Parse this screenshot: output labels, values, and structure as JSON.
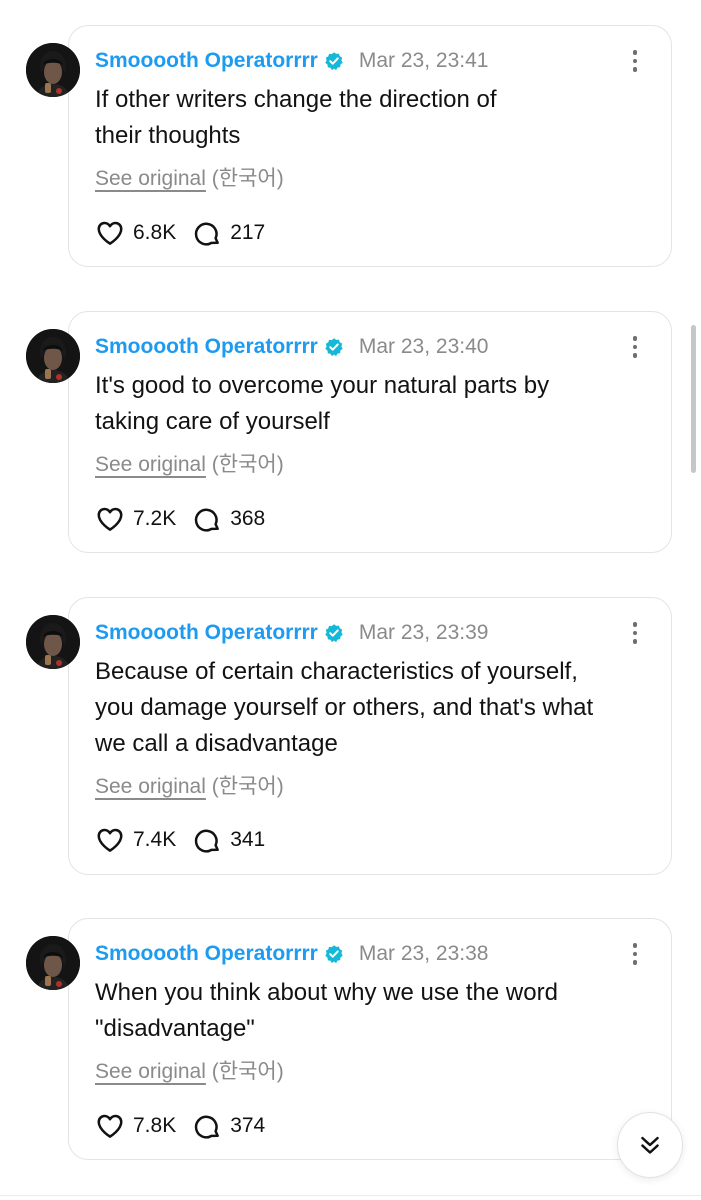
{
  "posts": [
    {
      "author": "Smooooth Operatorrrr",
      "timestamp": "Mar 23, 23:41",
      "lines": [
        "If other writers change the direction of",
        "their thoughts"
      ],
      "see_original": "See original",
      "language": "(한국어)",
      "likes": "6.8K",
      "replies": "217"
    },
    {
      "author": "Smooooth Operatorrrr",
      "timestamp": "Mar 23, 23:40",
      "lines": [
        "It's good to overcome your natural parts by",
        "taking care of yourself"
      ],
      "see_original": "See original",
      "language": "(한국어)",
      "likes": "7.2K",
      "replies": "368"
    },
    {
      "author": "Smooooth Operatorrrr",
      "timestamp": "Mar 23, 23:39",
      "lines": [
        "Because of certain characteristics of yourself,",
        "you damage yourself or others, and that's what",
        "we call a disadvantage"
      ],
      "see_original": "See original",
      "language": "(한국어)",
      "likes": "7.4K",
      "replies": "341"
    },
    {
      "author": "Smooooth Operatorrrr",
      "timestamp": "Mar 23, 23:38",
      "lines": [
        "When you think about why we use the word",
        "\"disadvantage\""
      ],
      "see_original": "See original",
      "language": "(한국어)",
      "likes": "7.8K",
      "replies": "374"
    }
  ],
  "icons": {
    "verified": "verified-badge-icon",
    "more": "more-vertical-icon",
    "like": "heart-icon",
    "reply": "speech-bubble-icon",
    "scroll_down": "double-chevron-down-icon"
  },
  "colors": {
    "accent": "#1d9bf0",
    "verified_badge": "#14b8d8",
    "muted": "#8a8a8a",
    "text": "#121212",
    "border": "#e4e4e4"
  }
}
